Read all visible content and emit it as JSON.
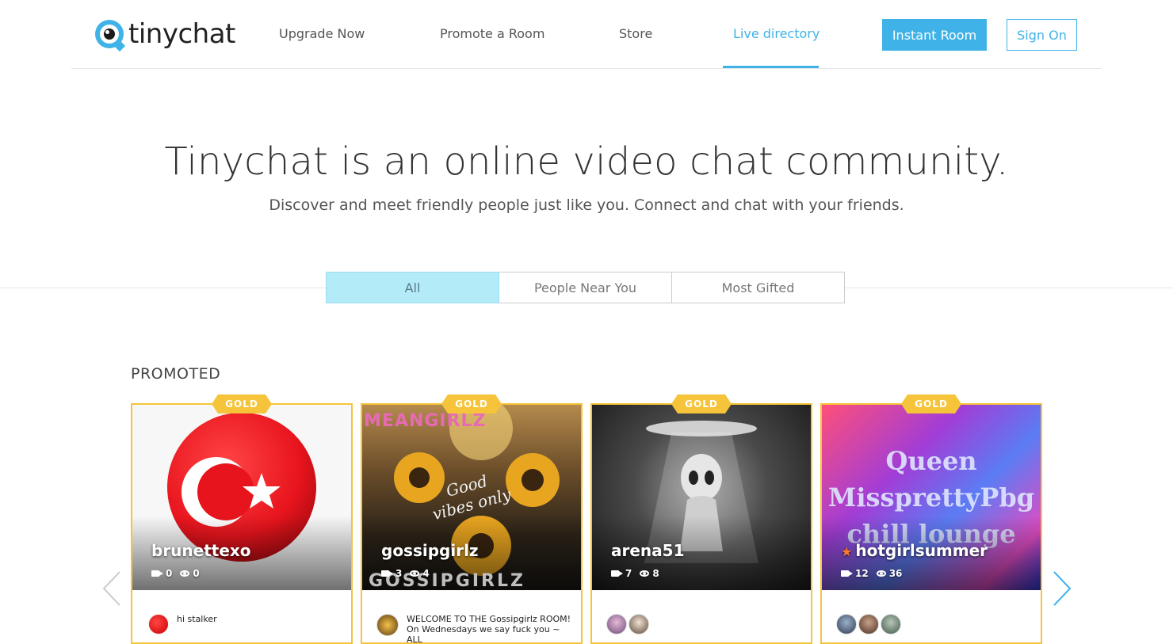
{
  "header": {
    "logo_text": "tinychat",
    "nav": [
      "Upgrade Now",
      "Promote a Room",
      "Store",
      "Live directory"
    ],
    "instant_room": "Instant Room",
    "sign_on": "Sign On"
  },
  "hero": {
    "title": "Tinychat is an online video chat community.",
    "subtitle": "Discover and meet friendly people just like you. Connect and chat with your friends."
  },
  "tabs": [
    "All",
    "People Near You",
    "Most Gifted"
  ],
  "active_tab": "All",
  "promoted": {
    "title": "PROMOTED",
    "badge": "GOLD",
    "cards": [
      {
        "name": "brunettexo",
        "cams": "0",
        "viewers": "0",
        "desc": "hi stalker",
        "image": "turkish-flag-image"
      },
      {
        "name": "gossipgirlz",
        "cams": "3",
        "viewers": "4",
        "desc": "WELCOME TO THE Gossipgirlz ROOM! On Wednesdays we say fuck you ~ ALL",
        "image_text_top": "MEANGIRLZ",
        "image_text_mid": "Good vibes only",
        "image_text_bottom": "GOSSIPGIRLZ"
      },
      {
        "name": "arena51",
        "cams": "7",
        "viewers": "8",
        "desc": "",
        "image": "alien-image"
      },
      {
        "name": "hotgirlsummer",
        "cams": "12",
        "viewers": "36",
        "desc": "",
        "image_text": "Queen MissprettyPbg chill lounge"
      }
    ]
  },
  "colors": {
    "accent": "#3fb3e8",
    "gold": "#f6c43a",
    "active_tab_bg": "#b3ecf8"
  }
}
